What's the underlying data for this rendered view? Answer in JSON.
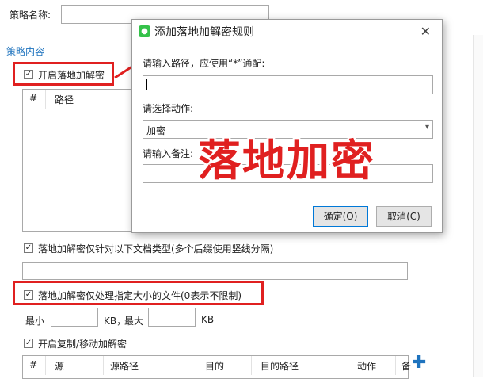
{
  "strategy_name": {
    "label": "策略名称:",
    "value": ""
  },
  "section_title": "策略内容",
  "landing_decrypt": {
    "label": "开启落地加解密",
    "checked": true
  },
  "rules_table": {
    "headers": [
      "#",
      "路径"
    ]
  },
  "filetype_option": {
    "label": "落地加解密仅针对以下文档类型(多个后缀使用竖线分隔)",
    "checked": true,
    "value": ""
  },
  "size_option": {
    "label": "落地加解密仅处理指定大小的文件(0表示不限制)",
    "checked": true
  },
  "size": {
    "min_label": "最小",
    "unit1": "KB，",
    "max_label": "最大",
    "unit2": "KB",
    "min_value": "",
    "max_value": ""
  },
  "copy_move": {
    "label": "开启复制/移动加解密",
    "checked": true
  },
  "copy_table": {
    "headers": [
      "#",
      "源",
      "源路径",
      "目的",
      "目的路径",
      "动作",
      "备"
    ]
  },
  "dialog": {
    "title": "添加落地加解密规则",
    "close_icon": "✕",
    "path_label": "请输入路径，应使用“*”通配:",
    "path_value": "",
    "action_label": "请选择动作:",
    "action_value": "加密",
    "note_label": "请输入备注:",
    "note_value": "",
    "ok": "确定(O)",
    "cancel": "取消(C)"
  },
  "overlay_caption": "落地加密",
  "colors": {
    "highlight": "#e02020",
    "link_blue": "#1e73be",
    "app_icon": "#35c24a"
  }
}
